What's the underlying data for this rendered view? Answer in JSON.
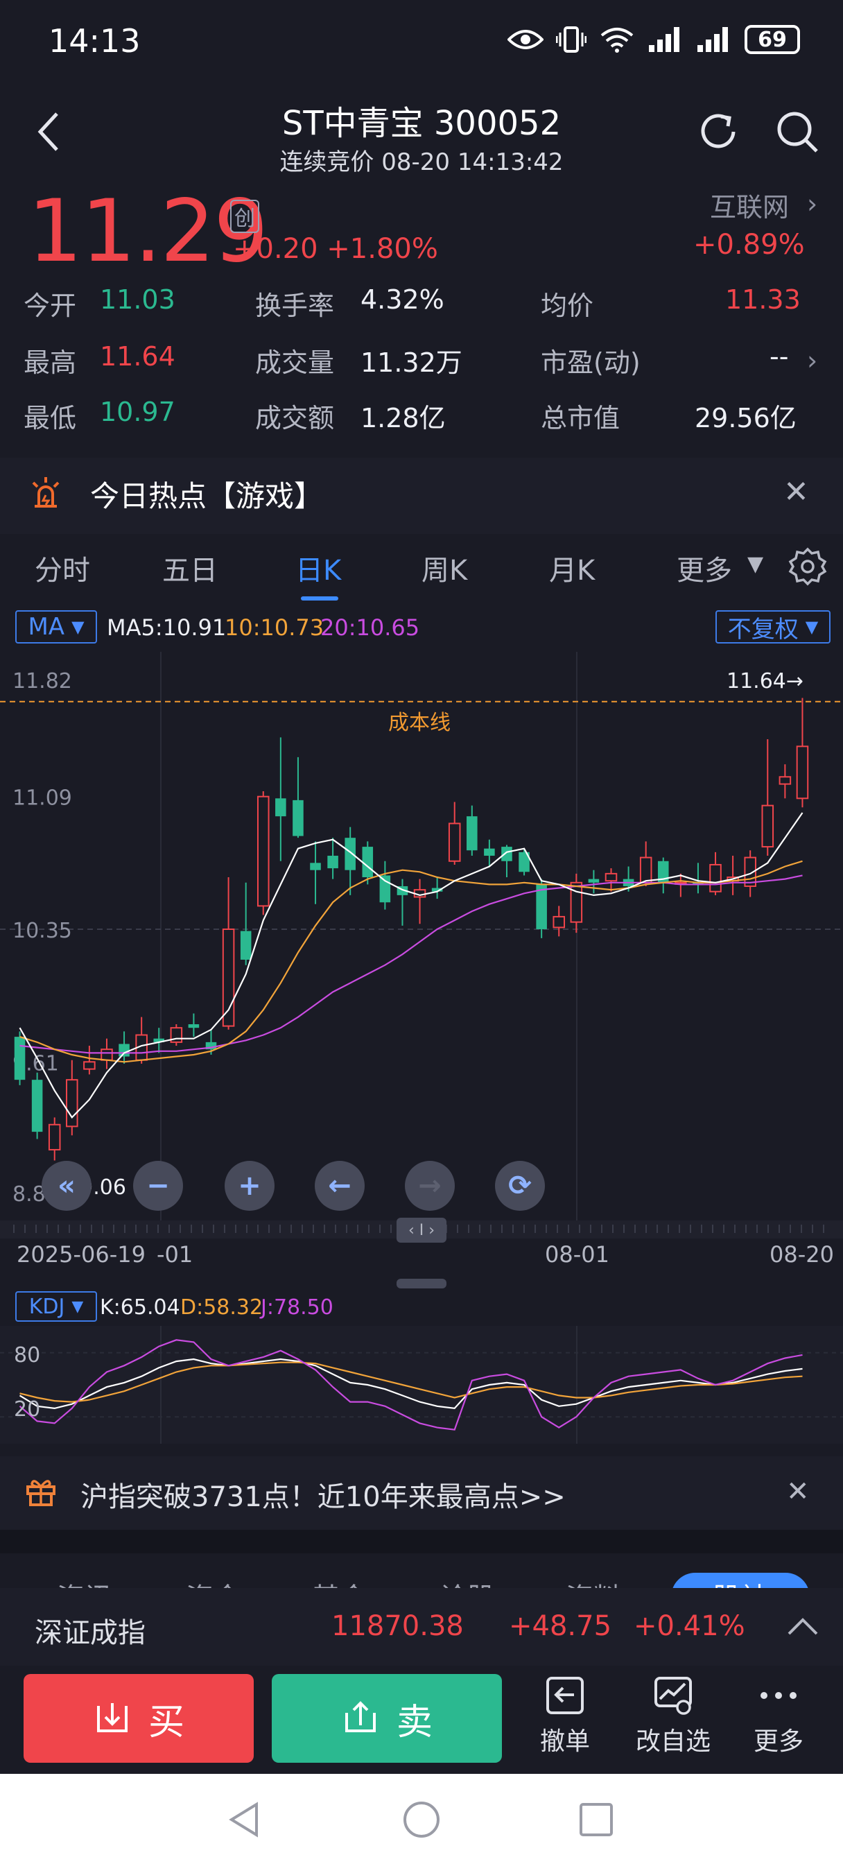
{
  "status": {
    "time": "14:13",
    "battery": "69"
  },
  "header": {
    "title": "ST中青宝 300052",
    "subtitle": "连续竞价 08-20 14:13:42"
  },
  "quote": {
    "price": "11.29",
    "board_badge": "创",
    "change": "+0.20 +1.80%",
    "sector_name": "互联网",
    "sector_change": "+0.89%"
  },
  "stats": {
    "open_label": "今开",
    "open": "11.03",
    "high_label": "最高",
    "high": "11.64",
    "low_label": "最低",
    "low": "10.97",
    "turnover_label": "换手率",
    "turnover": "4.32%",
    "volume_label": "成交量",
    "volume": "11.32万",
    "amount_label": "成交额",
    "amount": "1.28亿",
    "avg_label": "均价",
    "avg": "11.33",
    "pe_label": "市盈(动)",
    "pe": "--",
    "mktcap_label": "总市值",
    "mktcap": "29.56亿"
  },
  "hot": {
    "text": "今日热点【游戏】"
  },
  "tabs": [
    "分时",
    "五日",
    "日K",
    "周K",
    "月K",
    "更多"
  ],
  "active_tab": "日K",
  "kline": {
    "ma_selector": "MA",
    "ma5": "MA5:10.91",
    "ma10": "10:10.73",
    "ma20": "20:10.65",
    "adjust": "不复权",
    "cost_line_label": "成本线",
    "max_marker": "11.64→",
    "min_marker": "←9.06",
    "y_ticks": [
      "11.82",
      "11.09",
      "10.35",
      "9.61",
      "8.88"
    ],
    "x_ticks": [
      "2025-06-19",
      "-01",
      "08-01",
      "08-20"
    ],
    "pan_label": "‹ I ›",
    "colors": {
      "up": "#f0454b",
      "down": "#2bb990",
      "ma5": "#ffffff",
      "ma10": "#f2a43a",
      "ma20": "#c94ce0",
      "cost": "#f29a30"
    }
  },
  "chart_data": [
    {
      "type": "candlestick",
      "ylim": [
        8.88,
        11.82
      ],
      "y_ticks": [
        11.82,
        11.09,
        10.35,
        9.61,
        8.88
      ],
      "x_ticks": [
        "2025-06-19",
        "-01",
        "08-01",
        "08-20"
      ],
      "cost_line": 11.62,
      "candles": [
        [
          9.75,
          9.51,
          9.78,
          9.48
        ],
        [
          9.51,
          9.22,
          9.55,
          9.18
        ],
        [
          9.12,
          9.26,
          9.3,
          9.06
        ],
        [
          9.25,
          9.51,
          9.62,
          9.2
        ],
        [
          9.57,
          9.61,
          9.7,
          9.54
        ],
        [
          9.62,
          9.68,
          9.74,
          9.57
        ],
        [
          9.71,
          9.64,
          9.78,
          9.6
        ],
        [
          9.62,
          9.76,
          9.86,
          9.6
        ],
        [
          9.74,
          9.72,
          9.8,
          9.66
        ],
        [
          9.72,
          9.8,
          9.82,
          9.7
        ],
        [
          9.82,
          9.8,
          9.88,
          9.75
        ],
        [
          9.72,
          9.68,
          9.79,
          9.65
        ],
        [
          9.81,
          10.35,
          10.64,
          9.79
        ],
        [
          10.34,
          10.18,
          10.61,
          10.15
        ],
        [
          10.48,
          11.09,
          11.12,
          10.43
        ],
        [
          11.08,
          10.98,
          11.42,
          10.73
        ],
        [
          11.07,
          10.87,
          11.31,
          10.86
        ],
        [
          10.72,
          10.68,
          10.84,
          10.49
        ],
        [
          10.76,
          10.69,
          10.86,
          10.63
        ],
        [
          10.86,
          10.68,
          10.92,
          10.54
        ],
        [
          10.81,
          10.64,
          10.84,
          10.6
        ],
        [
          10.65,
          10.5,
          10.73,
          10.46
        ],
        [
          10.59,
          10.54,
          10.63,
          10.37
        ],
        [
          10.53,
          10.57,
          10.63,
          10.38
        ],
        [
          10.58,
          10.56,
          10.64,
          10.52
        ],
        [
          10.73,
          10.94,
          11.06,
          10.71
        ],
        [
          10.98,
          10.79,
          11.04,
          10.76
        ],
        [
          10.8,
          10.76,
          10.85,
          10.7
        ],
        [
          10.81,
          10.73,
          10.82,
          10.64
        ],
        [
          10.78,
          10.67,
          10.8,
          10.65
        ],
        [
          10.6,
          10.35,
          10.63,
          10.3
        ],
        [
          10.36,
          10.42,
          10.48,
          10.31
        ],
        [
          10.39,
          10.61,
          10.66,
          10.33
        ],
        [
          10.63,
          10.61,
          10.68,
          10.55
        ],
        [
          10.62,
          10.66,
          10.69,
          10.56
        ],
        [
          10.63,
          10.59,
          10.7,
          10.56
        ],
        [
          10.61,
          10.75,
          10.84,
          10.59
        ],
        [
          10.73,
          10.61,
          10.75,
          10.55
        ],
        [
          10.61,
          10.61,
          10.66,
          10.53
        ],
        [
          10.61,
          10.6,
          10.72,
          10.55
        ],
        [
          10.56,
          10.71,
          10.78,
          10.54
        ],
        [
          10.62,
          10.64,
          10.76,
          10.54
        ],
        [
          10.59,
          10.75,
          10.79,
          10.53
        ],
        [
          10.81,
          11.04,
          11.41,
          10.76
        ],
        [
          11.16,
          11.2,
          11.27,
          11.08
        ],
        [
          11.08,
          11.37,
          11.64,
          11.03
        ]
      ],
      "ma5": [
        9.8,
        9.63,
        9.45,
        9.3,
        9.4,
        9.55,
        9.66,
        9.7,
        9.72,
        9.74,
        9.74,
        9.79,
        9.9,
        10.1,
        10.4,
        10.6,
        10.8,
        10.83,
        10.85,
        10.78,
        10.7,
        10.62,
        10.57,
        10.54,
        10.56,
        10.62,
        10.66,
        10.7,
        10.78,
        10.8,
        10.62,
        10.6,
        10.56,
        10.54,
        10.55,
        10.58,
        10.62,
        10.63,
        10.65,
        10.62,
        10.61,
        10.63,
        10.66,
        10.72,
        10.86,
        11.0
      ],
      "ma10": [
        9.75,
        9.72,
        9.68,
        9.65,
        9.63,
        9.62,
        9.61,
        9.62,
        9.63,
        9.64,
        9.65,
        9.67,
        9.71,
        9.78,
        9.9,
        10.05,
        10.22,
        10.37,
        10.5,
        10.58,
        10.63,
        10.66,
        10.68,
        10.67,
        10.64,
        10.62,
        10.61,
        10.6,
        10.6,
        10.61,
        10.6,
        10.6,
        10.59,
        10.58,
        10.57,
        10.58,
        10.6,
        10.61,
        10.62,
        10.61,
        10.61,
        10.62,
        10.63,
        10.66,
        10.7,
        10.73
      ],
      "ma20": [
        9.7,
        9.69,
        9.68,
        9.67,
        9.66,
        9.66,
        9.66,
        9.66,
        9.67,
        9.67,
        9.68,
        9.69,
        9.71,
        9.73,
        9.76,
        9.8,
        9.86,
        9.93,
        10.0,
        10.05,
        10.1,
        10.15,
        10.21,
        10.28,
        10.35,
        10.4,
        10.45,
        10.49,
        10.52,
        10.55,
        10.57,
        10.58,
        10.59,
        10.6,
        10.61,
        10.61,
        10.61,
        10.61,
        10.6,
        10.6,
        10.6,
        10.61,
        10.61,
        10.62,
        10.63,
        10.65
      ]
    },
    {
      "type": "line",
      "title": "KDJ",
      "ylim": [
        0,
        100
      ],
      "y_ticks": [
        80,
        20
      ],
      "series": [
        {
          "name": "K",
          "values": [
            40,
            30,
            28,
            32,
            40,
            48,
            52,
            58,
            66,
            72,
            74,
            70,
            68,
            70,
            72,
            74,
            72,
            68,
            60,
            52,
            50,
            46,
            40,
            34,
            30,
            28,
            46,
            50,
            52,
            50,
            36,
            30,
            32,
            38,
            44,
            48,
            50,
            52,
            54,
            52,
            50,
            52,
            56,
            60,
            63,
            65
          ]
        },
        {
          "name": "D",
          "values": [
            42,
            38,
            35,
            34,
            36,
            40,
            44,
            50,
            56,
            62,
            66,
            68,
            68,
            69,
            70,
            71,
            71,
            70,
            66,
            62,
            58,
            54,
            50,
            46,
            42,
            38,
            42,
            46,
            48,
            48,
            44,
            40,
            38,
            38,
            40,
            43,
            45,
            47,
            49,
            50,
            50,
            51,
            53,
            55,
            57,
            58
          ]
        },
        {
          "name": "J",
          "values": [
            30,
            16,
            14,
            28,
            48,
            62,
            68,
            76,
            86,
            92,
            90,
            74,
            68,
            72,
            76,
            82,
            74,
            64,
            48,
            34,
            34,
            30,
            22,
            14,
            10,
            8,
            54,
            58,
            60,
            54,
            20,
            10,
            20,
            38,
            52,
            58,
            60,
            62,
            64,
            56,
            50,
            54,
            62,
            70,
            75,
            78
          ]
        }
      ]
    }
  ],
  "kdj": {
    "selector": "KDJ",
    "k": "K:65.04",
    "d": "D:58.32",
    "j": "J:78.50",
    "y_ticks": [
      "80",
      "20"
    ]
  },
  "notice": {
    "text": "沪指突破3731点！近10年来最高点>>"
  },
  "partial_tabs": [
    "资讯",
    "资金",
    "基金",
    "诊股",
    "资料",
    "股社"
  ],
  "index_bar": {
    "name": "深证成指",
    "value": "11870.38",
    "change": "+48.75",
    "pct": "+0.41%"
  },
  "trade": {
    "buy": "买",
    "sell": "卖"
  },
  "tools": [
    {
      "label": "撤单"
    },
    {
      "label": "改自选"
    },
    {
      "label": "更多"
    }
  ]
}
